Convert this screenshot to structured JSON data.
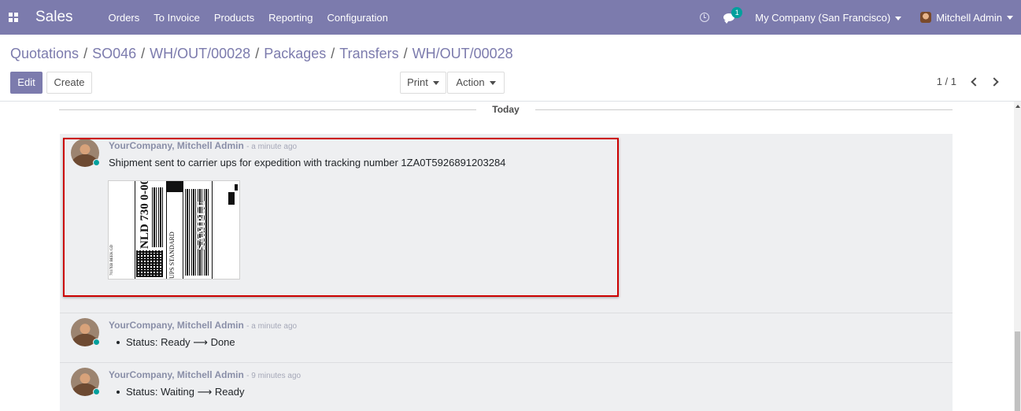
{
  "navbar": {
    "app_name": "Sales",
    "menu": [
      "Orders",
      "To Invoice",
      "Products",
      "Reporting",
      "Configuration"
    ],
    "chat_badge": "1",
    "company": "My Company (San Francisco)",
    "user": "Mitchell Admin",
    "color": "#7c7bad"
  },
  "breadcrumb": [
    "Quotations",
    "SO046",
    "WH/OUT/00028",
    "Packages",
    "Transfers",
    "WH/OUT/00028"
  ],
  "buttons": {
    "edit": "Edit",
    "create": "Create",
    "print": "Print",
    "action": "Action"
  },
  "pager": {
    "value": "1 / 1"
  },
  "chatter": {
    "separator": "Today",
    "messages": [
      {
        "author": "YourCompany, Mitchell Admin",
        "date": "- a minute ago",
        "body": "Shipment sent to carrier ups for expedition with tracking number 1ZA0T5926891203284",
        "attachment": {
          "label_texts": [
            "NLD 730 0-00",
            "SAMPLE",
            "UPS STANDARD",
            "7037EB BEEK GD"
          ]
        }
      },
      {
        "author": "YourCompany, Mitchell Admin",
        "date": "- a minute ago",
        "tracking": {
          "field": "Status:",
          "old": "Ready",
          "new": "Done"
        }
      },
      {
        "author": "YourCompany, Mitchell Admin",
        "date": "- 9 minutes ago",
        "tracking": {
          "field": "Status:",
          "old": "Waiting",
          "new": "Ready"
        }
      }
    ]
  }
}
